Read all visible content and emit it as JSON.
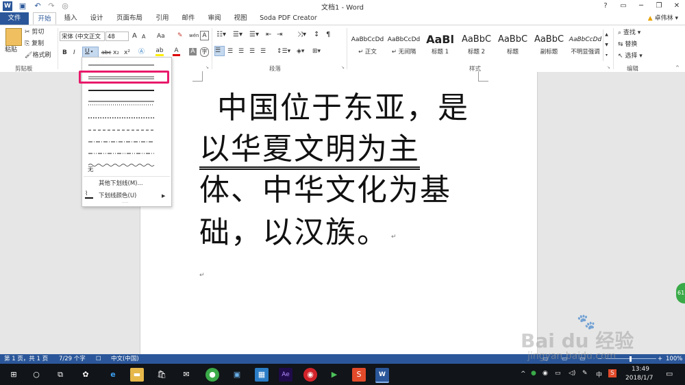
{
  "window": {
    "title": "文档1 - Word",
    "help_glyph": "?",
    "controls": [
      "▭",
      "─",
      "❐",
      "✕"
    ],
    "quick_access": [
      "W",
      "💾",
      "↶",
      "↷",
      "◎"
    ]
  },
  "tabs": [
    "文件",
    "开始",
    "插入",
    "设计",
    "页面布局",
    "引用",
    "邮件",
    "审阅",
    "视图",
    "Soda PDF Creator"
  ],
  "user": "卓伟林",
  "clipboard": {
    "paste": "粘贴",
    "cut": "剪切",
    "copy": "复制",
    "format_painter": "格式刷",
    "group_label": "剪贴板"
  },
  "font": {
    "font_name": "宋体 (中文正文",
    "font_size": "48",
    "grow": "A",
    "shrink": "A",
    "change_case": "Aa",
    "buttons": [
      "B",
      "I",
      "U",
      "abc",
      "x₂",
      "x²"
    ]
  },
  "paragraph": {
    "group_label": "段落"
  },
  "styles": {
    "group_label": "样式",
    "items": [
      {
        "sample": "AaBbCcDd",
        "name": "↵ 正文",
        "size": "9px",
        "weight": "normal"
      },
      {
        "sample": "AaBbCcDd",
        "name": "↵ 无间隔",
        "size": "9px",
        "weight": "normal"
      },
      {
        "sample": "AaBl",
        "name": "标题 1",
        "size": "16px",
        "weight": "bold"
      },
      {
        "sample": "AaBbC",
        "name": "标题 2",
        "size": "13px",
        "weight": "normal"
      },
      {
        "sample": "AaBbC",
        "name": "标题",
        "size": "13px",
        "weight": "normal"
      },
      {
        "sample": "AaBbC",
        "name": "副标题",
        "size": "13px",
        "weight": "normal"
      },
      {
        "sample": "AaBbCcDd",
        "name": "不明显强调",
        "size": "9px",
        "weight": "normal"
      }
    ]
  },
  "editing": {
    "find": "查找",
    "replace": "替换",
    "select": "选择",
    "group_label": "编辑"
  },
  "document": {
    "lines": [
      "中国位于东亚，是",
      "以华夏文明为主",
      "体、中华文化为基",
      "础，以汉族。"
    ],
    "para_mark": "↵"
  },
  "underline_menu": {
    "none_label": "无",
    "more_label": "其他下划线(M)...",
    "color_label": "下划线颜色(U)",
    "more_dots": "....."
  },
  "status": {
    "page": "第 1 页，共 1 页",
    "words": "7/29 个字",
    "language": "中文(中国)",
    "zoom": "100%"
  },
  "taskbar": {
    "time": "13:49",
    "date": "2018/1/7",
    "ime": "中"
  },
  "watermark": {
    "brand": "Bai du 经验",
    "url": "jingyan.baidu.com"
  },
  "side_badge": "61"
}
